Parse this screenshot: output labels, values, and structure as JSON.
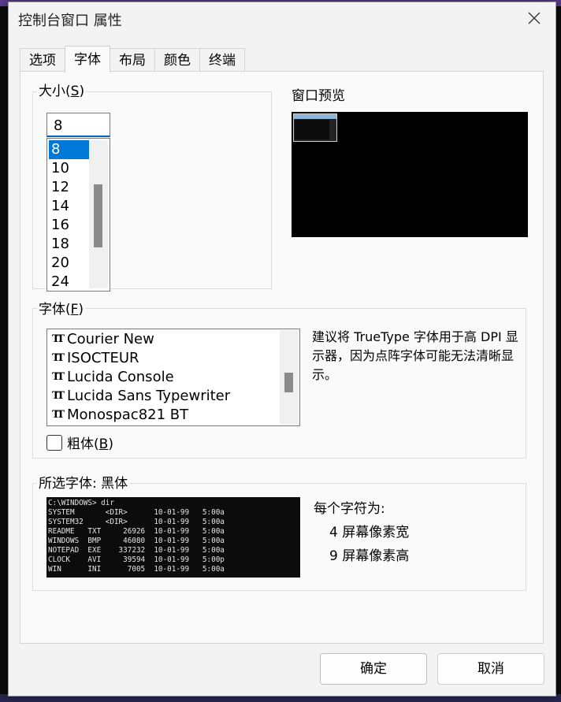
{
  "window": {
    "title": "控制台窗口 属性",
    "close_label": "×"
  },
  "tabs": [
    {
      "label": "选项"
    },
    {
      "label": "字体"
    },
    {
      "label": "布局"
    },
    {
      "label": "颜色"
    },
    {
      "label": "终端"
    }
  ],
  "size_group": {
    "label_main": "大小(",
    "label_key": "S",
    "label_end": ")",
    "input_value": "8",
    "options": [
      "8",
      "10",
      "12",
      "14",
      "16",
      "18",
      "20",
      "24"
    ],
    "selected_index": 0
  },
  "preview": {
    "label": "窗口预览"
  },
  "font_group": {
    "label_main": "字体(",
    "label_key": "F",
    "label_end": ")",
    "fonts": [
      "Courier New",
      "ISOCTEUR",
      "Lucida Console",
      "Lucida Sans Typewriter",
      "Monospac821 BT"
    ],
    "truetype_icon": "truetype-icon",
    "hint": "建议将 TrueType 字体用于高 DPI 显示器，因为点阵字体可能无法清晰显示。",
    "bold_main": "粗体(",
    "bold_key": "B",
    "bold_end": ")",
    "bold_checked": false
  },
  "selected_font": {
    "label": "所选字体: 黑体",
    "sample_lines": [
      "C:\\WINDOWS> dir",
      "SYSTEM       <DIR>      10-01-99   5:00a",
      "SYSTEM32     <DIR>      10-01-99   5:00a",
      "README   TXT     26926  10-01-99   5:00a",
      "WINDOWS  BMP     46080  10-01-99   5:00a",
      "NOTEPAD  EXE    337232  10-01-99   5:00a",
      "CLOCK    AVI     39594  10-01-99   5:00p",
      "WIN      INI      7005  10-01-99   5:00a"
    ],
    "char_info_title": "每个字符为:",
    "width_text": "4 屏幕像素宽",
    "height_text": "9 屏幕像素高"
  },
  "buttons": {
    "ok": "确定",
    "cancel": "取消"
  },
  "colors": {
    "accent": "#0078d7",
    "focus_border": "#0067c0"
  }
}
